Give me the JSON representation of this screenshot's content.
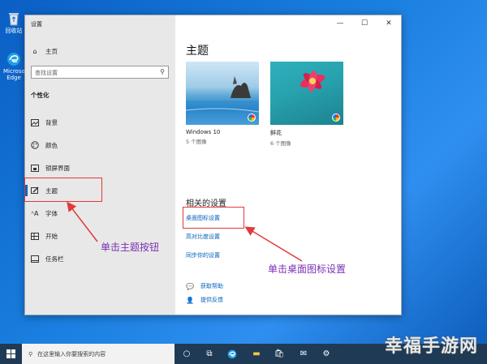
{
  "desktop": {
    "recycle_bin_label": "回收站",
    "edge_label": "Microsoft Edge"
  },
  "window": {
    "title": "设置",
    "controls": {
      "minimize": "—",
      "maximize": "☐",
      "close": "✕"
    }
  },
  "sidebar": {
    "home_label": "主页",
    "search_placeholder": "查找设置",
    "section_title": "个性化",
    "items": [
      {
        "label": "背景",
        "icon": "picture-icon"
      },
      {
        "label": "颜色",
        "icon": "palette-icon"
      },
      {
        "label": "锁屏界面",
        "icon": "lockscreen-icon"
      },
      {
        "label": "主题",
        "icon": "brush-icon",
        "active": true
      },
      {
        "label": "字体",
        "icon": "font-icon"
      },
      {
        "label": "开始",
        "icon": "start-icon"
      },
      {
        "label": "任务栏",
        "icon": "taskbar-icon"
      }
    ]
  },
  "main": {
    "title": "主题",
    "themes": [
      {
        "name": "Windows 10",
        "count": "5 个图像"
      },
      {
        "name": "鲜花",
        "count": "6 个图像"
      }
    ],
    "related_title": "相关的设置",
    "related_links": [
      "桌面图标设置",
      "高对比度设置",
      "同步你的设置"
    ],
    "help": [
      {
        "label": "获取帮助",
        "icon": "help-chat-icon"
      },
      {
        "label": "提供反馈",
        "icon": "feedback-icon"
      }
    ]
  },
  "annotations": {
    "theme_button": "单击主题按钮",
    "desktop_icon_settings": "单击桌面图标设置"
  },
  "taskbar": {
    "search_placeholder": "在这里输入你要搜索的内容"
  },
  "watermark": "幸福手游网",
  "colors": {
    "accent": "#0067c0",
    "annotation_box": "#e23a3a",
    "annotation_text": "#7a2fb4"
  }
}
